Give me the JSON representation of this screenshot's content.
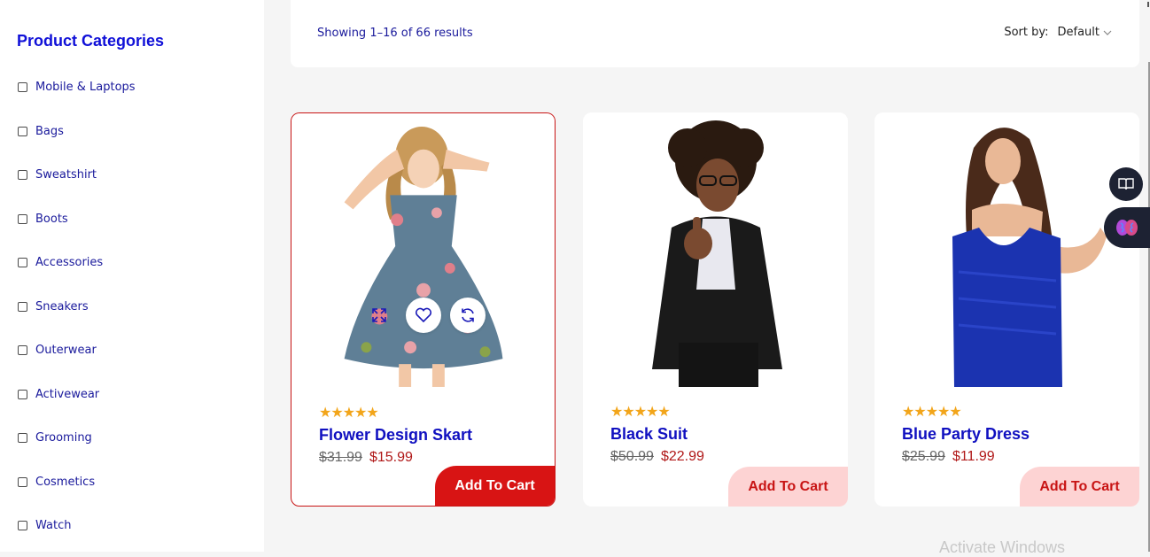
{
  "sidebar": {
    "title": "Product Categories",
    "categories": [
      "Mobile & Laptops",
      "Bags",
      "Sweatshirt",
      "Boots",
      "Accessories",
      "Sneakers",
      "Outerwear",
      "Activewear",
      "Grooming",
      "Cosmetics",
      "Watch"
    ]
  },
  "toolbar": {
    "results_text": "Showing 1–16 of 66 results",
    "sort_label": "Sort by:",
    "sort_value": "Default"
  },
  "products": [
    {
      "name": "Flower Design Skart",
      "stars": "★★★★★",
      "old_price": "$31.99",
      "price": "$15.99",
      "cart_label": "Add To Cart"
    },
    {
      "name": "Black Suit",
      "stars": "★★★★★",
      "old_price": "$50.99",
      "price": "$22.99",
      "cart_label": "Add To Cart"
    },
    {
      "name": "Blue Party Dress",
      "stars": "★★★★★",
      "old_price": "$25.99",
      "price": "$11.99",
      "cart_label": "Add To Cart"
    }
  ],
  "watermark": "Activate Windows",
  "colors": {
    "accent": "#d81414",
    "link": "#1010d8",
    "star": "#f2a51a"
  }
}
